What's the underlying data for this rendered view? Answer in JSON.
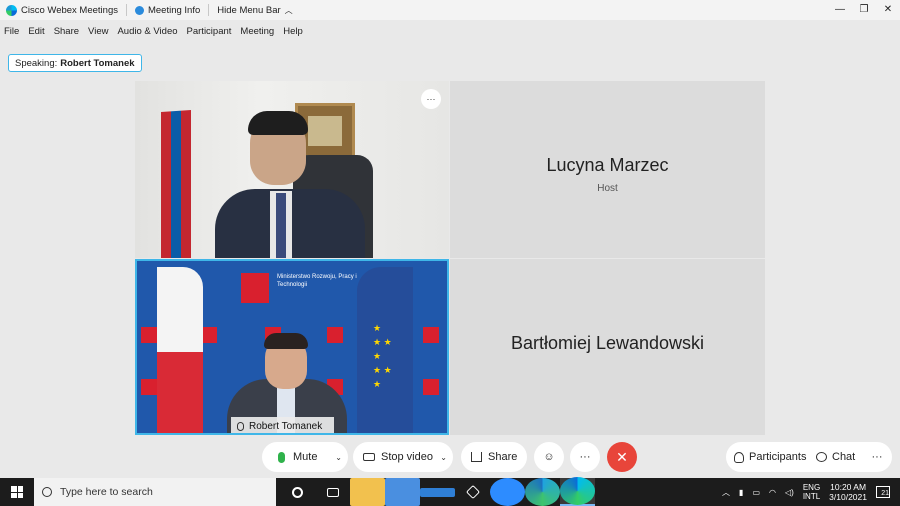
{
  "titlebar": {
    "app_name": "Cisco Webex Meetings",
    "meeting_info": "Meeting Info",
    "hide_menu": "Hide Menu Bar",
    "minimize": "—",
    "restore": "❐",
    "close": "✕"
  },
  "menu": [
    "File",
    "Edit",
    "Share",
    "View",
    "Audio & Video",
    "Participant",
    "Meeting",
    "Help"
  ],
  "speaking": {
    "prefix": "Speaking:",
    "name": "Robert Tomanek"
  },
  "tiles": {
    "host_name": "Lucyna Marzec",
    "host_role": "Host",
    "participant_name": "Bartłomiej Lewandowski",
    "active_speaker_tag": "Robert Tomanek",
    "ministry_text": "Ministerstwo Rozwoju, Pracy i Technologii",
    "more_glyph": "···"
  },
  "controls": {
    "mute": "Mute",
    "stop_video": "Stop video",
    "share": "Share",
    "reactions_glyph": "☺",
    "more_glyph": "···",
    "leave_glyph": "✕",
    "participants": "Participants",
    "chat": "Chat",
    "caret": "⌄"
  },
  "taskbar": {
    "search_placeholder": "Type here to search",
    "lang_top": "ENG",
    "lang_bottom": "INTL",
    "time": "10:20 AM",
    "date": "3/10/2021",
    "notifications": "21"
  },
  "colors": {
    "accent": "#3fb6e8",
    "leave": "#e8453a",
    "mic_active": "#2fb24b"
  }
}
